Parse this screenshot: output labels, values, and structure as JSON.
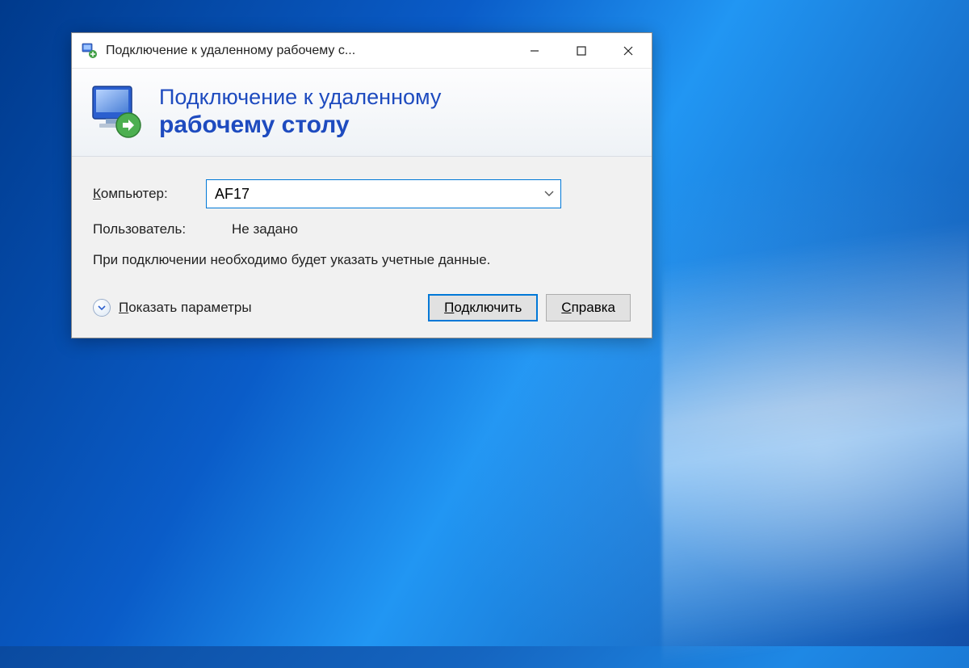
{
  "titlebar": {
    "title": "Подключение к удаленному рабочему с..."
  },
  "banner": {
    "line1": "Подключение к удаленному",
    "line2": "рабочему столу"
  },
  "form": {
    "computer_label_prefix": "К",
    "computer_label_rest": "омпьютер:",
    "computer_value": "AF17",
    "user_label": "Пользователь:",
    "user_value": "Не задано",
    "info_text": "При подключении необходимо будет указать учетные данные."
  },
  "footer": {
    "show_options_prefix": "П",
    "show_options_rest": "оказать параметры",
    "connect_prefix": "П",
    "connect_rest": "одключить",
    "help_prefix": "С",
    "help_rest": "правка"
  }
}
